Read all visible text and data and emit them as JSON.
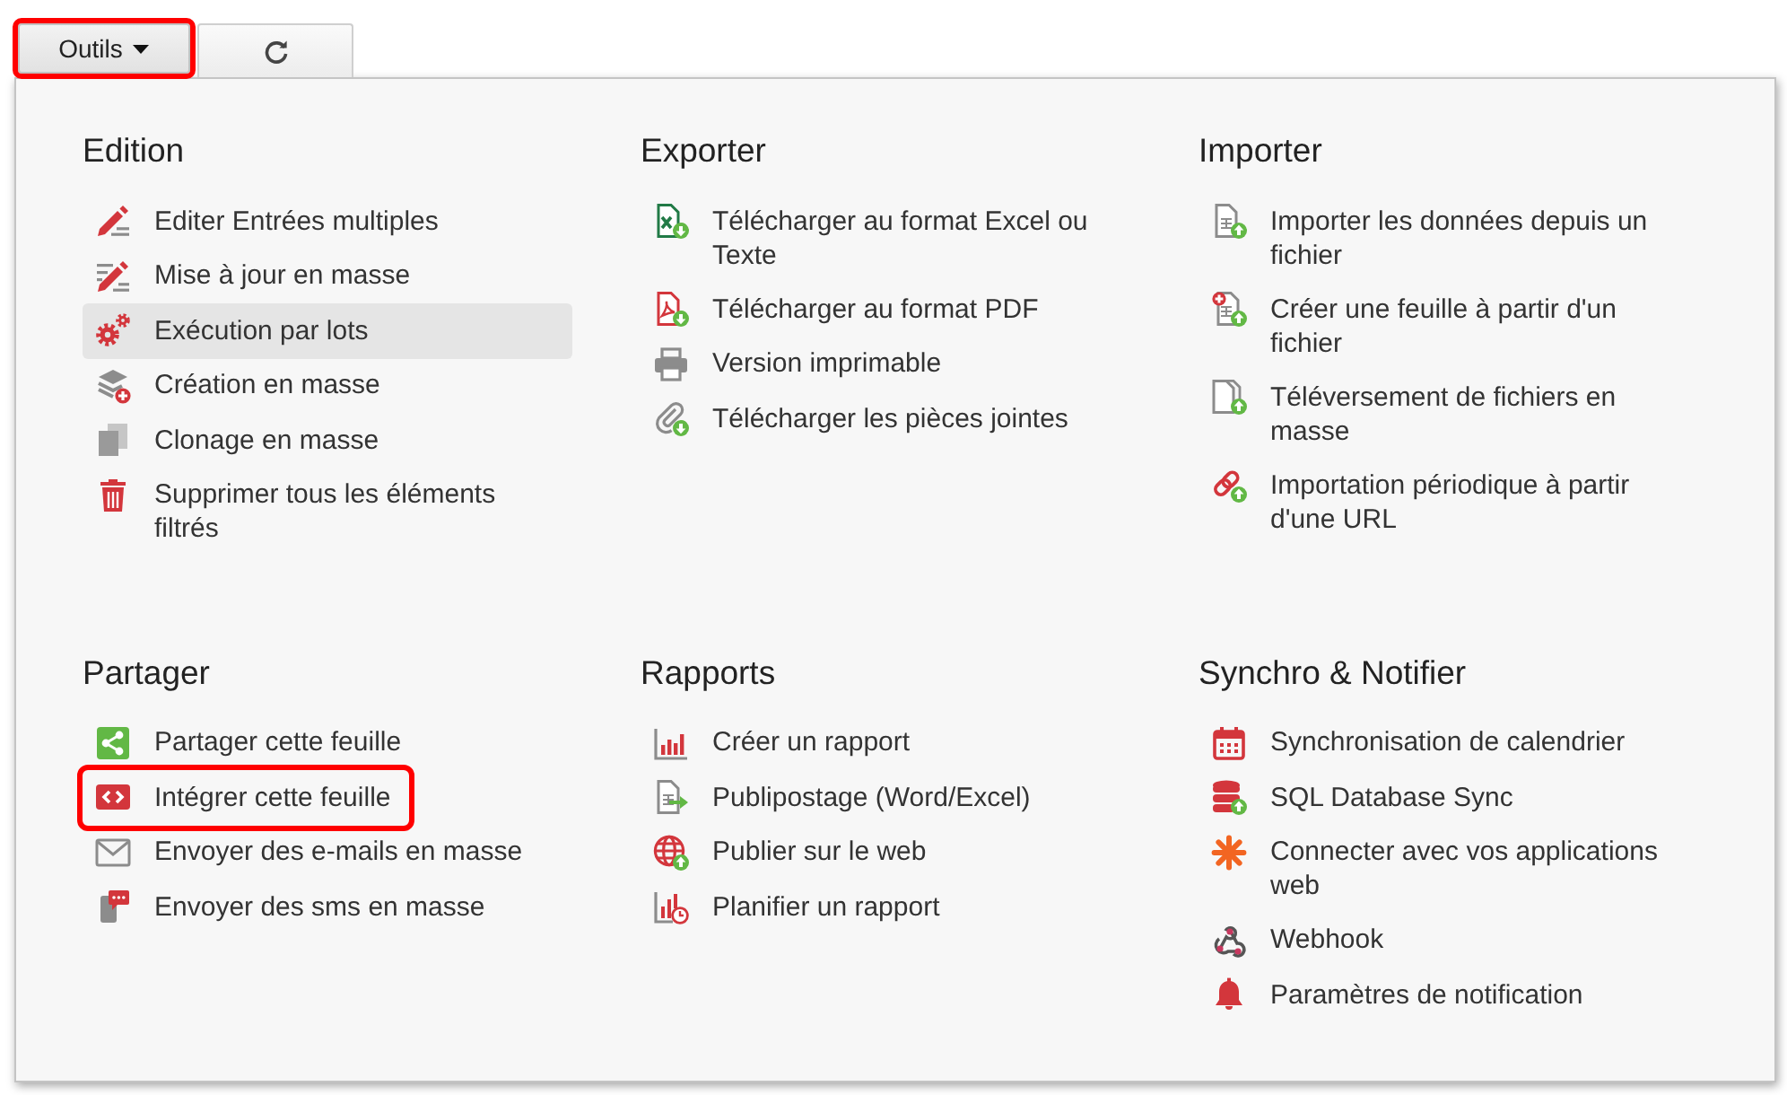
{
  "toolbar": {
    "tools_button": {
      "label": "Outils",
      "expanded": true,
      "highlighted": true
    }
  },
  "menu": {
    "sections": [
      {
        "title": "Edition",
        "items": [
          {
            "label": "Editer Entrées multiples",
            "hovered": false,
            "highlighted": false
          },
          {
            "label": "Mise à jour en masse",
            "hovered": false,
            "highlighted": false
          },
          {
            "label": "Exécution par lots",
            "hovered": true,
            "highlighted": false
          },
          {
            "label": "Création en masse",
            "hovered": false,
            "highlighted": false
          },
          {
            "label": "Clonage en masse",
            "hovered": false,
            "highlighted": false
          },
          {
            "label": "Supprimer tous les éléments filtrés",
            "hovered": false,
            "highlighted": false
          }
        ]
      },
      {
        "title": "Exporter",
        "items": [
          {
            "label": "Télécharger au format Excel ou Texte",
            "hovered": false,
            "highlighted": false
          },
          {
            "label": "Télécharger au format PDF",
            "hovered": false,
            "highlighted": false
          },
          {
            "label": "Version imprimable",
            "hovered": false,
            "highlighted": false
          },
          {
            "label": "Télécharger les pièces jointes",
            "hovered": false,
            "highlighted": false
          }
        ]
      },
      {
        "title": "Importer",
        "items": [
          {
            "label": "Importer les données depuis un fichier",
            "hovered": false,
            "highlighted": false
          },
          {
            "label": "Créer une feuille à partir d'un fichier",
            "hovered": false,
            "highlighted": false
          },
          {
            "label": "Téléversement de fichiers en masse",
            "hovered": false,
            "highlighted": false
          },
          {
            "label": "Importation périodique à partir d'une URL",
            "hovered": false,
            "highlighted": false
          }
        ]
      },
      {
        "title": "Partager",
        "items": [
          {
            "label": "Partager cette feuille",
            "hovered": false,
            "highlighted": false
          },
          {
            "label": "Intégrer cette feuille",
            "hovered": false,
            "highlighted": true
          },
          {
            "label": "Envoyer des e-mails en masse",
            "hovered": false,
            "highlighted": false
          },
          {
            "label": "Envoyer des sms en masse",
            "hovered": false,
            "highlighted": false
          }
        ]
      },
      {
        "title": "Rapports",
        "items": [
          {
            "label": "Créer un rapport",
            "hovered": false,
            "highlighted": false
          },
          {
            "label": "Publipostage (Word/Excel)",
            "hovered": false,
            "highlighted": false
          },
          {
            "label": "Publier sur le web",
            "hovered": false,
            "highlighted": false
          },
          {
            "label": "Planifier un rapport",
            "hovered": false,
            "highlighted": false
          }
        ]
      },
      {
        "title": "Synchro & Notifier",
        "items": [
          {
            "label": "Synchronisation de calendrier",
            "hovered": false,
            "highlighted": false
          },
          {
            "label": "SQL Database Sync",
            "hovered": false,
            "highlighted": false
          },
          {
            "label": "Connecter avec vos applications web",
            "hovered": false,
            "highlighted": false
          },
          {
            "label": "Webhook",
            "hovered": false,
            "highlighted": false
          },
          {
            "label": "Paramètres de notification",
            "hovered": false,
            "highlighted": false
          }
        ]
      }
    ]
  }
}
